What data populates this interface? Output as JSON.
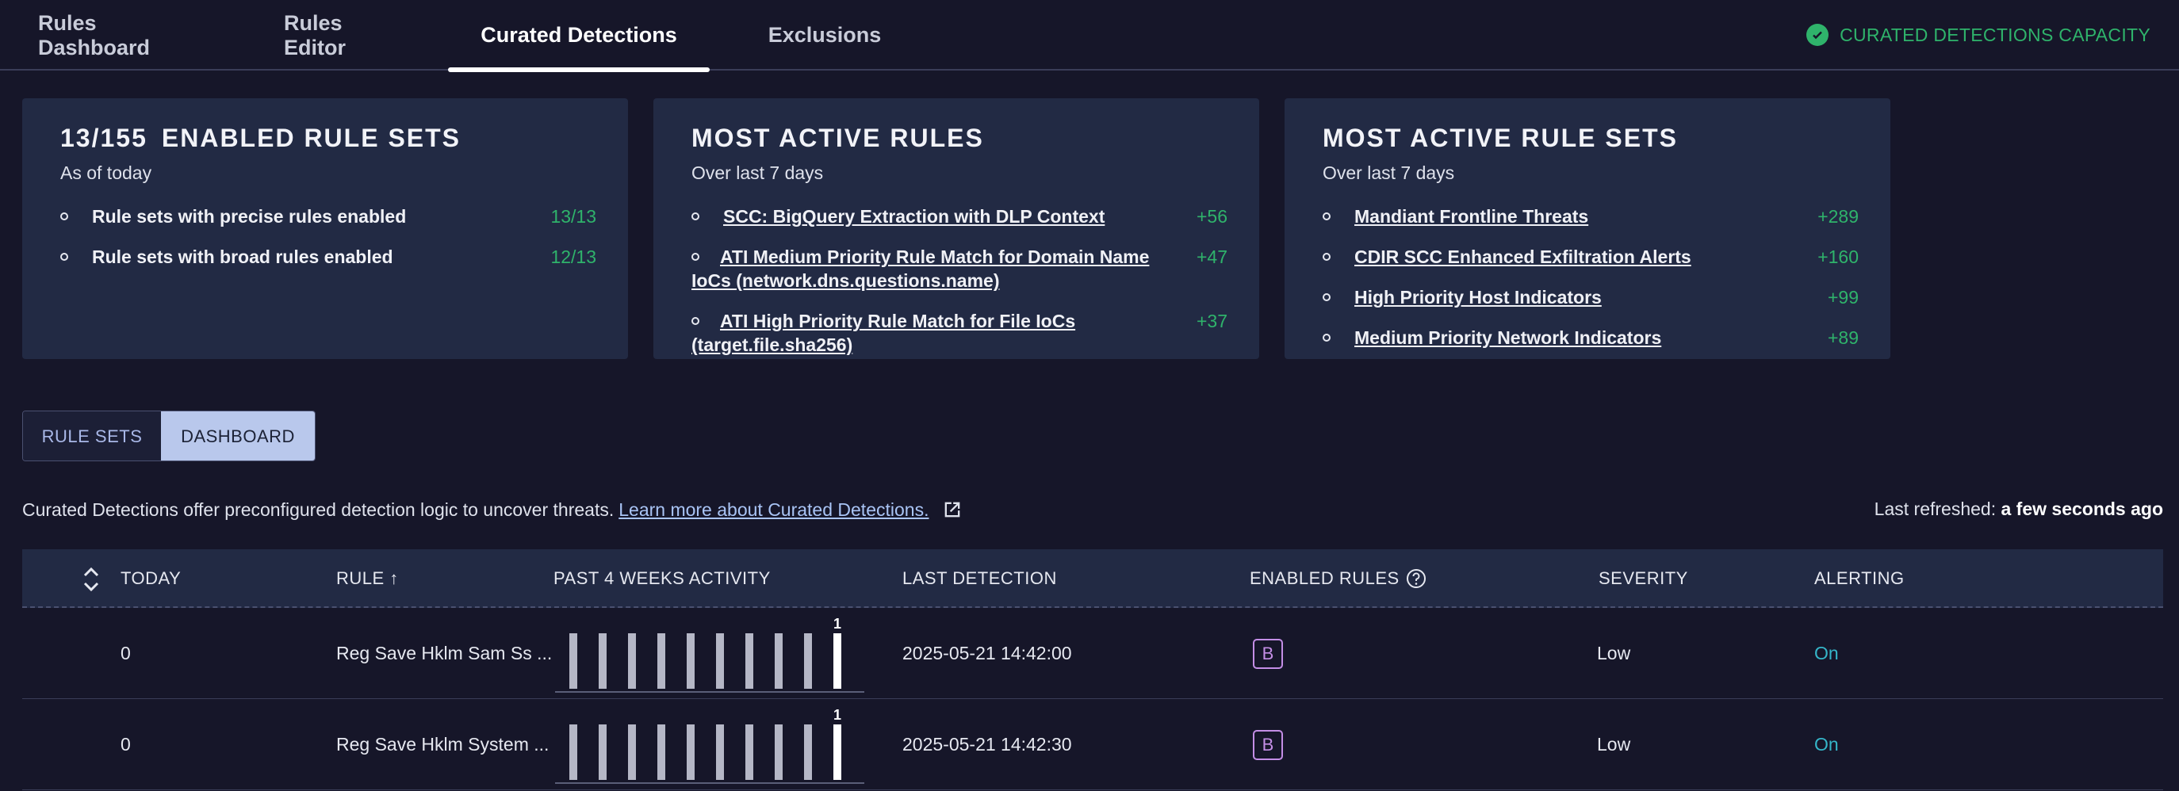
{
  "nav": {
    "tabs": [
      {
        "label": "Rules Dashboard"
      },
      {
        "label": "Rules Editor"
      },
      {
        "label": "Curated Detections"
      },
      {
        "label": "Exclusions"
      }
    ],
    "active_tab": "Curated Detections",
    "capacity_label": "CURATED DETECTIONS CAPACITY"
  },
  "cards": {
    "enabled": {
      "count": "13/155",
      "title": "ENABLED RULE SETS",
      "subtitle": "As of today",
      "items": [
        {
          "label": "Rule sets with precise rules enabled",
          "value": "13/13"
        },
        {
          "label": "Rule sets with broad rules enabled",
          "value": "12/13"
        }
      ]
    },
    "active_rules": {
      "title": "MOST ACTIVE RULES",
      "subtitle": "Over last 7 days",
      "items": [
        {
          "label": " SCC: BigQuery Extraction with DLP Context",
          "value": "+56"
        },
        {
          "label": " ATI Medium Priority Rule Match for Domain Name IoCs (network.dns.questions.name)",
          "value": "+47"
        },
        {
          "label": " ATI High Priority Rule Match for File IoCs (target.file.sha256)",
          "value": "+37"
        }
      ]
    },
    "active_rule_sets": {
      "title": "MOST ACTIVE RULE SETS",
      "subtitle": "Over last 7 days",
      "items": [
        {
          "label": "Mandiant Frontline Threats",
          "value": "+289"
        },
        {
          "label": "CDIR SCC Enhanced Exfiltration Alerts",
          "value": "+160"
        },
        {
          "label": "High Priority Host Indicators",
          "value": "+99"
        },
        {
          "label": "Medium Priority Network Indicators",
          "value": "+89"
        }
      ]
    }
  },
  "view_toggle": {
    "rulesets_label": "RULE SETS",
    "dashboard_label": "DASHBOARD",
    "selected": "DASHBOARD"
  },
  "info": {
    "text": "Curated Detections offer preconfigured detection logic to uncover threats.",
    "learn_more": "Learn more about Curated Detections.",
    "refreshed_label": "Last refreshed:",
    "refreshed_value": "a few seconds ago"
  },
  "table": {
    "headers": {
      "today": "TODAY",
      "rule": "RULE ↑",
      "activity": "PAST 4 WEEKS ACTIVITY",
      "last_detection": "LAST DETECTION",
      "enabled_rules": "ENABLED RULES",
      "severity": "SEVERITY",
      "alerting": "ALERTING"
    },
    "rows": [
      {
        "today": "0",
        "rule": "Reg Save Hklm Sam Ss ...",
        "activity": [
          1,
          1,
          1,
          1,
          1,
          1,
          1,
          1,
          1,
          1
        ],
        "activity_peak_label": "1",
        "last_detection": "2025-05-21 14:42:00",
        "enabled_rule_badge": "B",
        "severity": "Low",
        "alerting": "On"
      },
      {
        "today": "0",
        "rule": "Reg Save Hklm System ...",
        "activity": [
          1,
          1,
          1,
          1,
          1,
          1,
          1,
          1,
          1,
          1
        ],
        "activity_peak_label": "1",
        "last_detection": "2025-05-21 14:42:30",
        "enabled_rule_badge": "B",
        "severity": "Low",
        "alerting": "On"
      }
    ]
  },
  "colors": {
    "background": "#161629",
    "card": "#222a44",
    "positive": "#2fb36b",
    "link": "#35b6c9",
    "badge": "#c48ee6"
  }
}
